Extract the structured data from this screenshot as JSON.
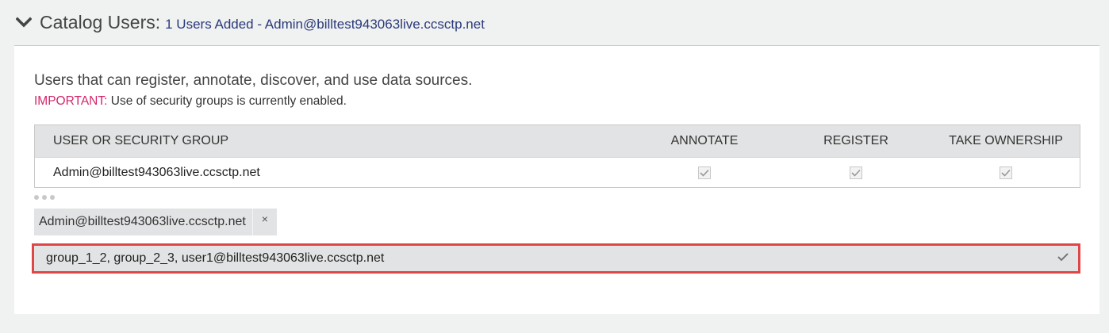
{
  "catalog": {
    "title": "Catalog Users:",
    "summary": "1 Users Added - Admin@billtest943063live.ccsctp.net"
  },
  "description": "Users that can register, annotate, discover, and use data sources.",
  "important": {
    "label": "IMPORTANT:",
    "text": " Use of security groups is currently enabled."
  },
  "table": {
    "headers": {
      "user": "USER OR SECURITY GROUP",
      "annotate": "ANNOTATE",
      "register": "REGISTER",
      "take_ownership": "TAKE OWNERSHIP"
    },
    "rows": [
      {
        "user": "Admin@billtest943063live.ccsctp.net",
        "annotate": true,
        "register": true,
        "take_ownership": true
      }
    ]
  },
  "selected_tag": {
    "label": "Admin@billtest943063live.ccsctp.net",
    "remove_glyph": "×"
  },
  "input": {
    "value": "group_1_2, group_2_3, user1@billtest943063live.ccsctp.net"
  },
  "icons": {
    "expand": "chevron-down-icon",
    "checkbox": "check-icon",
    "more": "more-dots-icon",
    "remove": "close-icon",
    "confirm": "check-icon"
  },
  "colors": {
    "accent_link": "#2a3a7a",
    "important": "#d4256a",
    "highlight_border": "#e04646",
    "header_bg": "#e2e3e4"
  }
}
